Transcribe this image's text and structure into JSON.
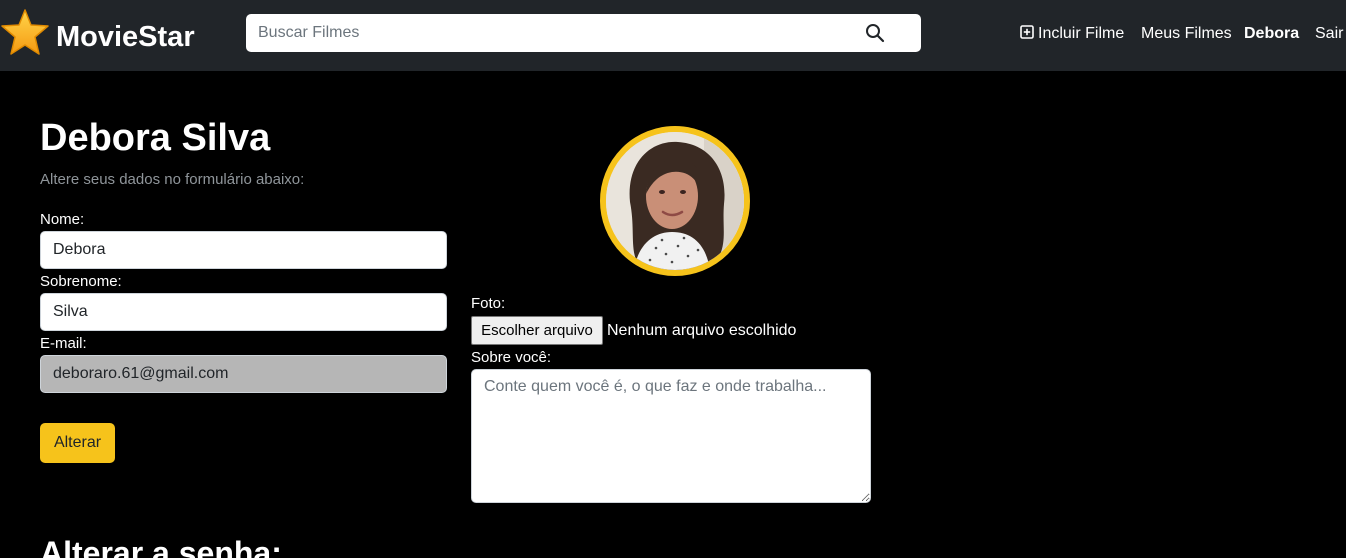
{
  "navbar": {
    "brand": "MovieStar",
    "brand_icon": "star-icon",
    "search_placeholder": "Buscar Filmes",
    "search_icon": "search-icon",
    "links": {
      "add_movie": "Incluir Filme",
      "my_movies": "Meus Filmes",
      "user": "Debora",
      "logout": "Sair"
    }
  },
  "profile": {
    "title": "Debora Silva",
    "subtitle": "Altere seus dados no formulário abaixo:",
    "name_label": "Nome:",
    "name_value": "Debora",
    "lastname_label": "Sobrenome:",
    "lastname_value": "Silva",
    "email_label": "E-mail:",
    "email_value": "deboraro.61@gmail.com",
    "submit_label": "Alterar",
    "photo_label": "Foto:",
    "file_button_label": "Escolher arquivo",
    "file_status": "Nenhum arquivo escolhido",
    "bio_label": "Sobre você:",
    "bio_placeholder": "Conte quem você é, o que faz e onde trabalha..."
  },
  "password": {
    "title": "Alterar a senha:"
  },
  "colors": {
    "accent": "#f6c31b",
    "navbar_bg": "#212529",
    "page_bg": "#000000"
  }
}
